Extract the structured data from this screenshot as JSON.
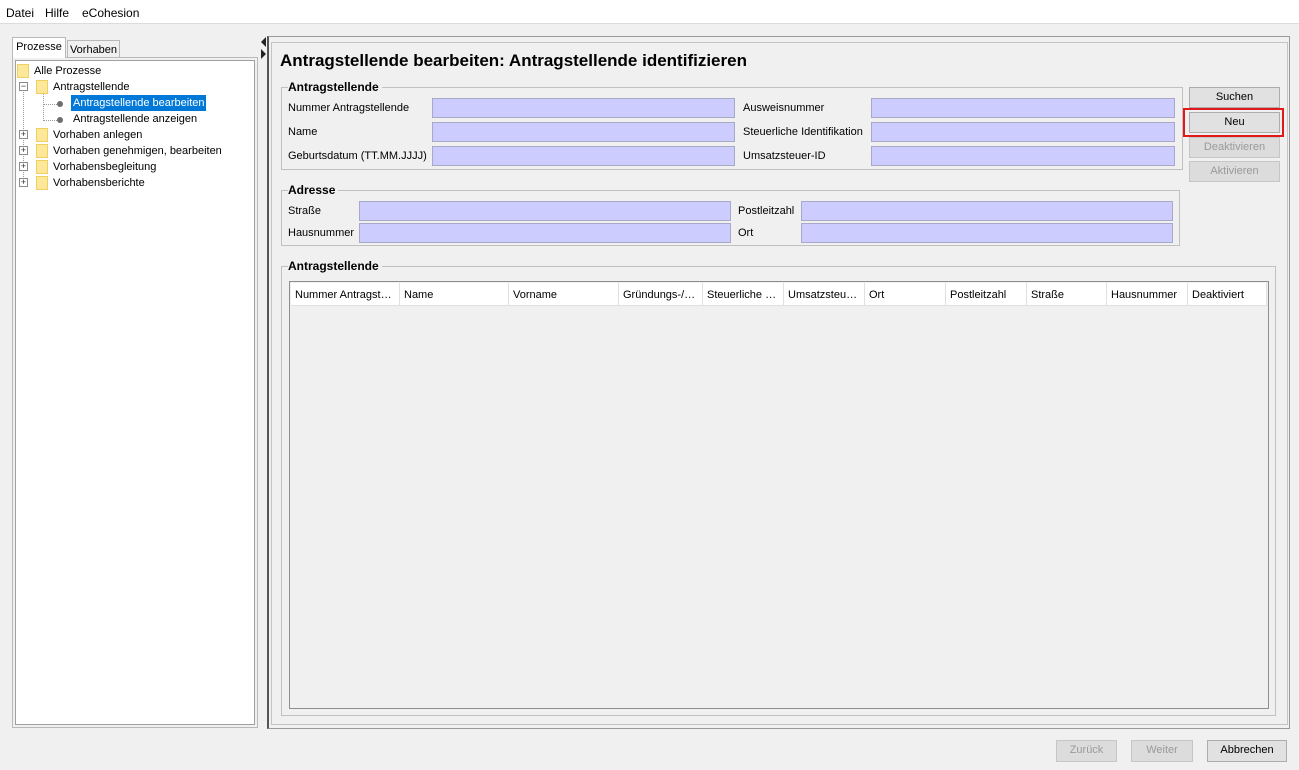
{
  "menu": [
    "Datei",
    "Hilfe",
    "eCohesion"
  ],
  "left_tabs": [
    "Prozesse",
    "Vorhaben"
  ],
  "tree": {
    "root": "Alle Prozesse",
    "antragstellende": "Antragstellende",
    "bearbeiten": "Antragstellende bearbeiten",
    "anzeigen": "Antragstellende anzeigen",
    "vorhaben_anlegen": "Vorhaben anlegen",
    "vorhaben_genehmigen": "Vorhaben genehmigen, bearbeiten",
    "vorhabensbegleitung": "Vorhabensbegleitung",
    "vorhabensberichte": "Vorhabensberichte"
  },
  "page_title": "Antragstellende bearbeiten: Antragstellende identifizieren",
  "search_group": {
    "title": "Antragstellende",
    "nummer_label": "Nummer Antragstellende",
    "name_label": "Name",
    "geburtsdatum_label": "Geburtsdatum (TT.MM.JJJJ)",
    "ausweis_label": "Ausweisnummer",
    "steuer_label": "Steuerliche Identifikation",
    "ust_label": "Umsatzsteuer-ID",
    "nummer_value": "",
    "name_value": "",
    "geburtsdatum_value": "",
    "ausweis_value": "",
    "steuer_value": "",
    "ust_value": ""
  },
  "address_group": {
    "title": "Adresse",
    "strasse_label": "Straße",
    "hausnummer_label": "Hausnummer",
    "plz_label": "Postleitzahl",
    "ort_label": "Ort",
    "strasse_value": "",
    "hausnummer_value": "",
    "plz_value": "",
    "ort_value": ""
  },
  "buttons": {
    "suchen": "Suchen",
    "neu": "Neu",
    "deaktivieren": "Deaktivieren",
    "aktivieren": "Aktivieren"
  },
  "results": {
    "title": "Antragstellende",
    "columns": [
      "Nummer Antragst…",
      "Name",
      "Vorname",
      "Gründungs-/…",
      "Steuerliche …",
      "Umsatzsteu…",
      "Ort",
      "Postleitzahl",
      "Straße",
      "Hausnummer",
      "Deaktiviert"
    ]
  },
  "footer": {
    "zurueck": "Zurück",
    "weiter": "Weiter",
    "abbrechen": "Abbrechen"
  },
  "colors": {
    "input_bg": "#ccccff",
    "selection": "#0078d7",
    "highlight": "#e0191a"
  }
}
